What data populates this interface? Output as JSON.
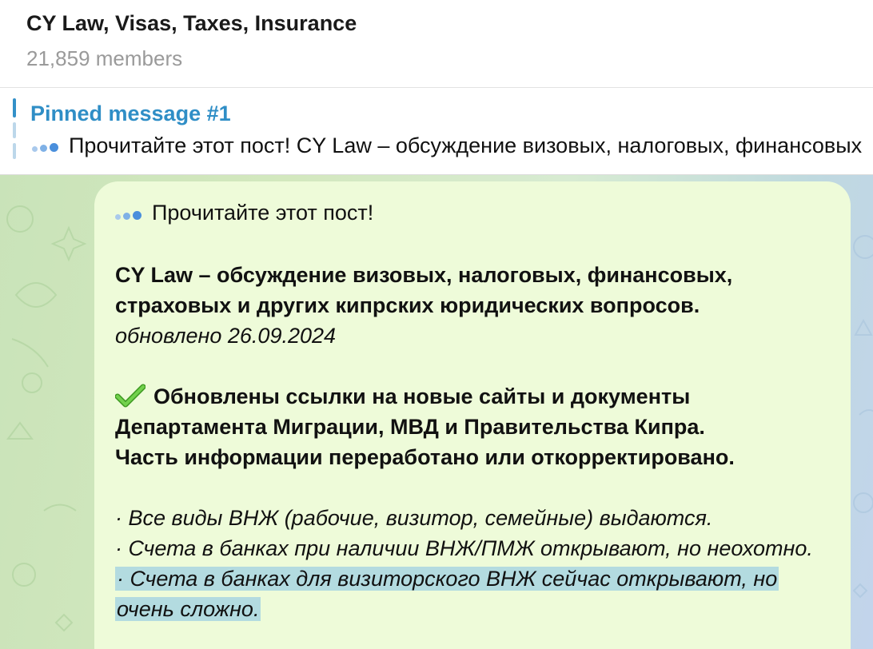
{
  "header": {
    "title": "CY Law, Visas, Taxes, Insurance",
    "members": "21,859 members"
  },
  "pinned": {
    "title": "Pinned message #1",
    "preview": "Прочитайте этот пост!  CY Law – обсуждение визовых, налоговых, финансовых"
  },
  "message": {
    "intro": "Прочитайте этот пост!",
    "headline_1": "CY Law – обсуждение визовых, налоговых, финансовых,",
    "headline_2": "страховых и других кипрских юридических вопросов.",
    "updated": "обновлено 26.09.2024",
    "update_1": "Обновлены ссылки на новые сайты и документы",
    "update_2": "Департамента Миграции, МВД и Правительства Кипра.",
    "update_3": "Часть информации переработано или откорректировано.",
    "bullet_1": "· Все виды ВНЖ (рабочие, визитор, семейные) выдаются.",
    "bullet_2": "· Счета в банках при наличии ВНЖ/ПМЖ открывают, но неохотно.",
    "bullet_3a": "· Счета в банках для визиторского ВНЖ сейчас открывают, но",
    "bullet_3b": "очень сложно."
  },
  "icons": {
    "dots": "three-dots-emoji",
    "check": "heavy-check-mark-emoji"
  },
  "colors": {
    "accent": "#2f8ec6",
    "bubble": "#eefbd9",
    "highlight": "#b3dbe0",
    "check": "#5bbf3a"
  }
}
